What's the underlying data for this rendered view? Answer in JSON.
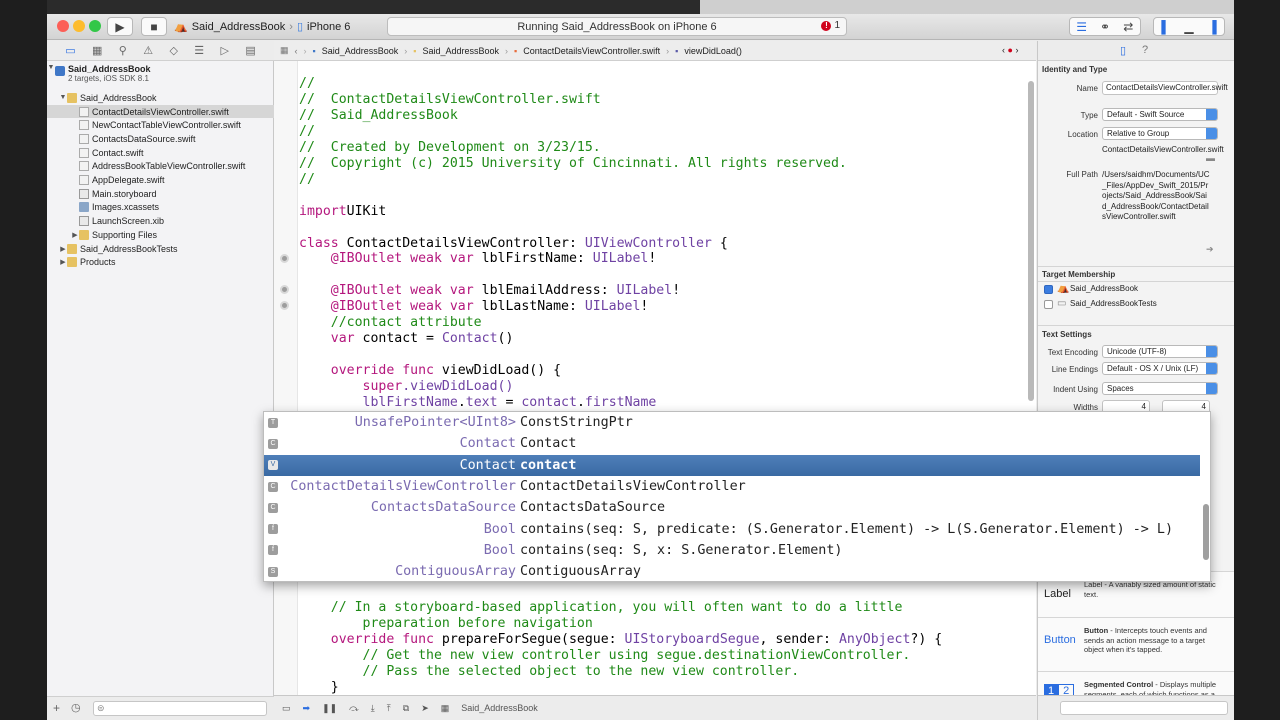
{
  "toolbar": {
    "scheme_target": "Said_AddressBook",
    "scheme_device": "iPhone 6",
    "activity_text": "Running Said_AddressBook on iPhone 6",
    "error_count": "1"
  },
  "navigator": {
    "project_name": "Said_AddressBook",
    "project_sub": "2 targets, iOS SDK 8.1",
    "items": [
      {
        "label": "Said_AddressBook",
        "kind": "folder",
        "level": 1,
        "disclosure": "▼"
      },
      {
        "label": "ContactDetailsViewController.swift",
        "kind": "swift",
        "level": 2,
        "selected": true
      },
      {
        "label": "NewContactTableViewController.swift",
        "kind": "swift",
        "level": 2
      },
      {
        "label": "ContactsDataSource.swift",
        "kind": "swift",
        "level": 2
      },
      {
        "label": "Contact.swift",
        "kind": "swift",
        "level": 2
      },
      {
        "label": "AddressBookTableViewController.swift",
        "kind": "swift",
        "level": 2
      },
      {
        "label": "AppDelegate.swift",
        "kind": "swift",
        "level": 2
      },
      {
        "label": "Main.storyboard",
        "kind": "sb",
        "level": 2
      },
      {
        "label": "Images.xcassets",
        "kind": "assets",
        "level": 2
      },
      {
        "label": "LaunchScreen.xib",
        "kind": "sb",
        "level": 2
      },
      {
        "label": "Supporting Files",
        "kind": "folder",
        "level": 2,
        "disclosure": "▶"
      },
      {
        "label": "Said_AddressBookTests",
        "kind": "folder",
        "level": 1,
        "disclosure": "▶"
      },
      {
        "label": "Products",
        "kind": "folder",
        "level": 1,
        "disclosure": "▶"
      }
    ]
  },
  "jumpbar": {
    "crumbs": [
      "Said_AddressBook",
      "Said_AddressBook",
      "ContactDetailsViewController.swift",
      "viewDidLoad()"
    ]
  },
  "code": [
    [
      [
        "cm",
        "//"
      ]
    ],
    [
      [
        "cm",
        "//  ContactDetailsViewController.swift"
      ]
    ],
    [
      [
        "cm",
        "//  Said_AddressBook"
      ]
    ],
    [
      [
        "cm",
        "//"
      ]
    ],
    [
      [
        "cm",
        "//  Created by Development on 3/23/15."
      ]
    ],
    [
      [
        "cm",
        "//  Copyright (c) 2015 University of Cincinnati. All rights reserved."
      ]
    ],
    [
      [
        "cm",
        "//"
      ]
    ],
    [],
    [
      [
        "kw",
        "import"
      ],
      [
        "",
        "UIKit"
      ]
    ],
    [],
    [
      [
        "kw",
        "class"
      ],
      [
        "",
        " ContactDetailsViewController: "
      ],
      [
        "ty",
        "UIViewController"
      ],
      [
        "",
        " {"
      ]
    ],
    [
      [
        "",
        "    "
      ],
      [
        "kw",
        "@IBOutlet weak var"
      ],
      [
        "",
        " lblFirstName: "
      ],
      [
        "ty",
        "UILabel"
      ],
      [
        "",
        "!"
      ]
    ],
    [],
    [
      [
        "",
        "    "
      ],
      [
        "kw",
        "@IBOutlet weak var"
      ],
      [
        "",
        " lblEmailAddress: "
      ],
      [
        "ty",
        "UILabel"
      ],
      [
        "",
        "!"
      ]
    ],
    [
      [
        "",
        "    "
      ],
      [
        "kw",
        "@IBOutlet weak var"
      ],
      [
        "",
        " lblLastName: "
      ],
      [
        "ty",
        "UILabel"
      ],
      [
        "",
        "!"
      ]
    ],
    [
      [
        "cm",
        "    //contact attribute"
      ]
    ],
    [
      [
        "",
        "    "
      ],
      [
        "kw",
        "var"
      ],
      [
        "",
        " contact = "
      ],
      [
        "ty",
        "Contact"
      ],
      [
        "",
        "()"
      ]
    ],
    [],
    [
      [
        "",
        "    "
      ],
      [
        "kw",
        "override func"
      ],
      [
        "",
        " viewDidLoad() {"
      ]
    ],
    [
      [
        "",
        "        "
      ],
      [
        "kw",
        "super"
      ],
      [
        "ty",
        ".viewDidLoad()"
      ]
    ],
    [
      [
        "",
        "        "
      ],
      [
        "ty",
        "lblFirstName"
      ],
      [
        "",
        "."
      ],
      [
        "ty",
        "text"
      ],
      [
        "",
        " = "
      ],
      [
        "ty",
        "contact"
      ],
      [
        "",
        "."
      ],
      [
        "ty",
        "firstName"
      ]
    ],
    [
      [
        "",
        "        lblLastName.text = con"
      ],
      [
        "ty",
        "tact"
      ]
    ]
  ],
  "code_lower": [
    [
      [
        "cm",
        "    // In a storyboard-based application, you will often want to do a little"
      ]
    ],
    [
      [
        "cm",
        "        preparation before navigation"
      ]
    ],
    [
      [
        "",
        "    "
      ],
      [
        "kw",
        "override func"
      ],
      [
        "",
        " prepareForSegue(segue: "
      ],
      [
        "ty",
        "UIStoryboardSegue"
      ],
      [
        "",
        ", sender: "
      ],
      [
        "ty",
        "AnyObject"
      ],
      [
        "",
        "?) {"
      ]
    ],
    [
      [
        "cm",
        "        // Get the new view controller using segue.destinationViewController."
      ]
    ],
    [
      [
        "cm",
        "        // Pass the selected object to the new view controller."
      ]
    ],
    [
      [
        "",
        "    }"
      ]
    ],
    [
      [
        "cm",
        "    */"
      ]
    ]
  ],
  "completions": [
    {
      "kind": "T",
      "type": "UnsafePointer<UInt8>",
      "name": "ConstStringPtr"
    },
    {
      "kind": "C",
      "type": "Contact",
      "name": "Contact"
    },
    {
      "kind": "V",
      "type": "Contact",
      "name": "contact",
      "selected": true
    },
    {
      "kind": "C",
      "type": "ContactDetailsViewController",
      "name": "ContactDetailsViewController"
    },
    {
      "kind": "C",
      "type": "ContactsDataSource",
      "name": "ContactsDataSource"
    },
    {
      "kind": "f",
      "type": "Bool",
      "name": "contains(seq: S, predicate: (S.Generator.Element) -> L(S.Generator.Element) -> L)"
    },
    {
      "kind": "f",
      "type": "Bool",
      "name": "contains(seq: S, x: S.Generator.Element)"
    },
    {
      "kind": "S",
      "type": "ContiguousArray",
      "name": "ContiguousArray"
    }
  ],
  "debug_bar": {
    "target": "Said_AddressBook"
  },
  "inspector": {
    "identity_title": "Identity and Type",
    "name_label": "Name",
    "name_value": "ContactDetailsViewController.swift",
    "type_label": "Type",
    "type_value": "Default - Swift Source",
    "location_label": "Location",
    "location_value": "Relative to Group",
    "location_file": "ContactDetailsViewController.swift",
    "fullpath_label": "Full Path",
    "fullpath_value": "/Users/saidhm/Documents/UC_Files/AppDev_Swift_2015/Projects/Said_AddressBook/Said_AddressBook/ContactDetailsViewController.swift",
    "membership_title": "Target Membership",
    "targets": [
      {
        "label": "Said_AddressBook",
        "checked": true
      },
      {
        "label": "Said_AddressBookTests",
        "checked": false
      }
    ],
    "text_settings_title": "Text Settings",
    "encoding_label": "Text Encoding",
    "encoding_value": "Unicode (UTF-8)",
    "line_endings_label": "Line Endings",
    "line_endings_value": "Default - OS X / Unix (LF)",
    "indent_label": "Indent Using",
    "indent_value": "Spaces",
    "widths_label": "Widths",
    "tab_width": "4",
    "indent_width": "4"
  },
  "library": [
    {
      "icon": "Label",
      "title": "",
      "desc": "Label - A variably sized amount of static text."
    },
    {
      "icon": "Button",
      "title": "Button",
      "desc": " - Intercepts touch events and sends an action message to a target object when it's tapped."
    },
    {
      "icon": "1 2",
      "title": "Segmented Control",
      "desc": " - Displays multiple segments, each of which functions as a discrete button."
    }
  ]
}
